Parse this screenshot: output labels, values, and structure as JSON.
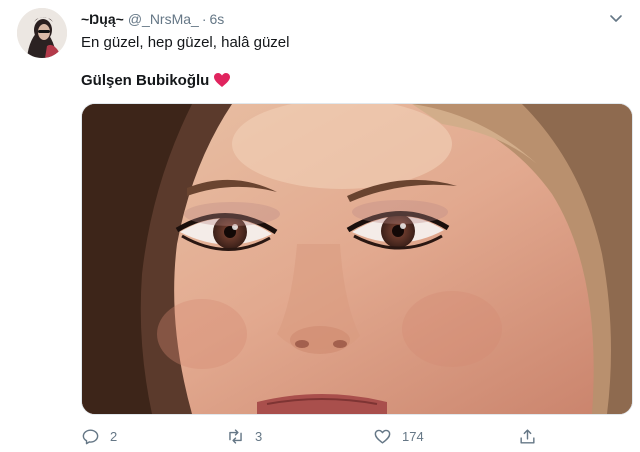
{
  "tweet": {
    "author": {
      "display_name": "~Ŋųą~",
      "handle": "@_NrsMa_",
      "separator": "·",
      "time": "6s"
    },
    "text_line1": "En güzel, hep güzel, halâ güzel",
    "text_line2": "Gülşen Bubikoğlu",
    "heart_emoji": "red-heart-icon",
    "media": {
      "description_icon": "photo-closeup-face"
    },
    "actions": {
      "replies": "2",
      "retweets": "3",
      "likes": "174"
    }
  },
  "colors": {
    "text": "#14171a",
    "muted": "#657786",
    "heart": "#e0245e",
    "border": "#e1e8ed"
  }
}
